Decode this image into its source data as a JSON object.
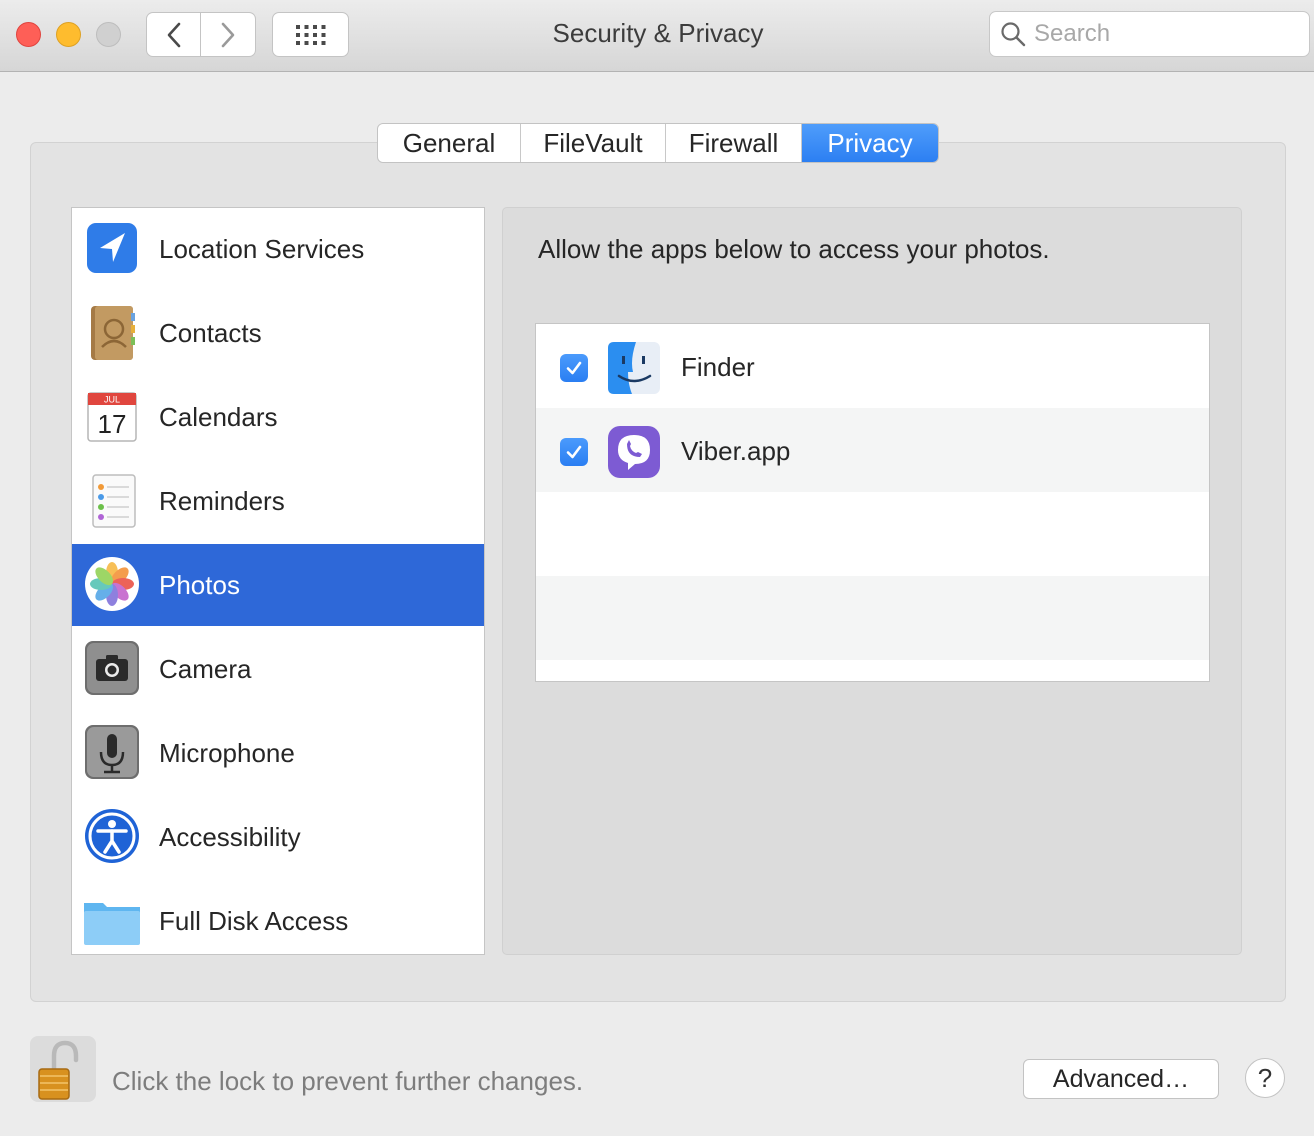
{
  "window": {
    "title": "Security & Privacy",
    "search_placeholder": "Search"
  },
  "tabs": [
    {
      "label": "General",
      "active": false
    },
    {
      "label": "FileVault",
      "active": false
    },
    {
      "label": "Firewall",
      "active": false
    },
    {
      "label": "Privacy",
      "active": true
    }
  ],
  "categories": [
    {
      "label": "Location Services",
      "icon": "location-services-icon"
    },
    {
      "label": "Contacts",
      "icon": "contacts-icon"
    },
    {
      "label": "Calendars",
      "icon": "calendar-icon"
    },
    {
      "label": "Reminders",
      "icon": "reminders-icon"
    },
    {
      "label": "Photos",
      "icon": "photos-icon",
      "selected": true
    },
    {
      "label": "Camera",
      "icon": "camera-icon"
    },
    {
      "label": "Microphone",
      "icon": "microphone-icon"
    },
    {
      "label": "Accessibility",
      "icon": "accessibility-icon"
    },
    {
      "label": "Full Disk Access",
      "icon": "folder-icon"
    }
  ],
  "calendar_icon": {
    "month": "JUL",
    "day": "17"
  },
  "pane": {
    "heading": "Allow the apps below to access your photos.",
    "apps": [
      {
        "name": "Finder",
        "checked": true,
        "icon": "finder-icon"
      },
      {
        "name": "Viber.app",
        "checked": true,
        "icon": "viber-icon"
      }
    ]
  },
  "footer": {
    "lock_text": "Click the lock to prevent further changes.",
    "advanced_label": "Advanced…",
    "help_label": "?"
  },
  "colors": {
    "accent": "#2e68d8",
    "tab_active": "#3a8af6",
    "checkbox": "#3a8af6"
  }
}
